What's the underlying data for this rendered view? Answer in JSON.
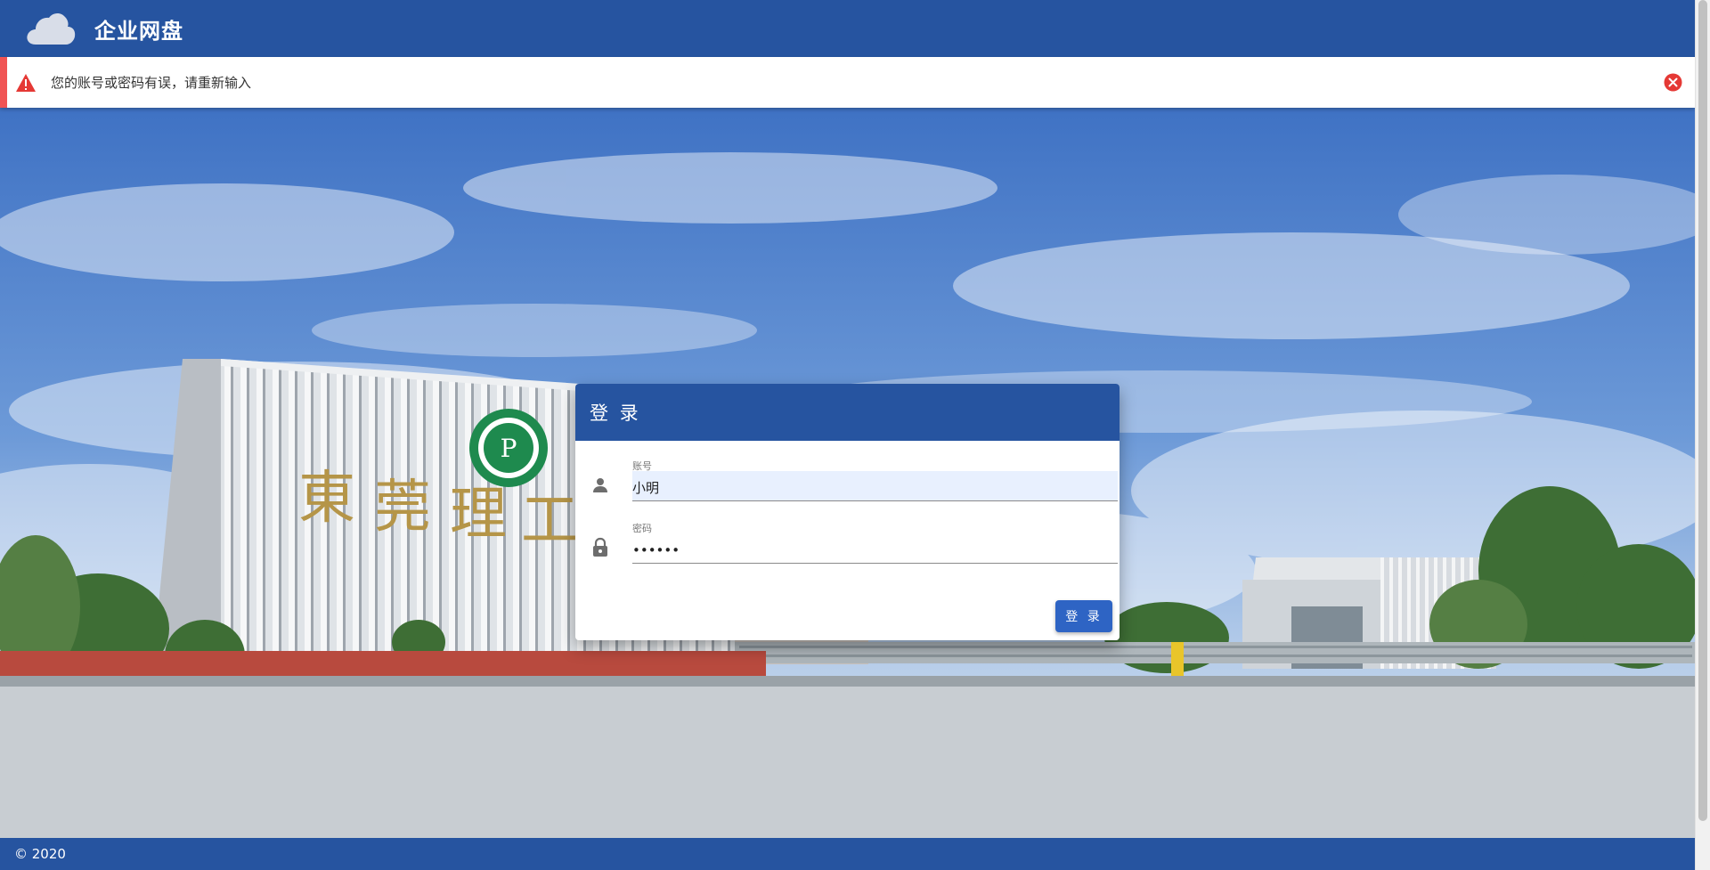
{
  "header": {
    "icon": "cloud-icon",
    "title": "企业网盘"
  },
  "alert": {
    "icon": "warning-icon",
    "message": "您的账号或密码有误，请重新输入",
    "close_icon": "close-circle-icon",
    "color": "#f05454"
  },
  "login": {
    "title": "登 录",
    "account": {
      "icon": "person-icon",
      "label": "账号",
      "value": "小明"
    },
    "password": {
      "icon": "lock-icon",
      "label": "密码",
      "value": "••••••"
    },
    "submit_label": "登 录"
  },
  "footer": {
    "copyright": "© 2020"
  },
  "colors": {
    "primary": "#2654a0",
    "button": "#2e64c4",
    "alert_accent": "#f05454"
  }
}
